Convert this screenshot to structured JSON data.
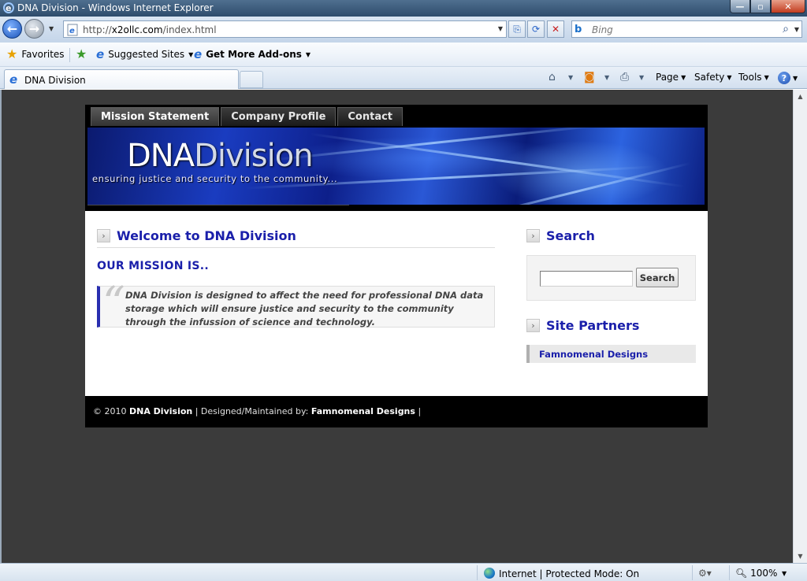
{
  "window": {
    "title": "DNA Division - Windows Internet Explorer",
    "min_label": "—",
    "max_label": "▫",
    "close_label": "✕"
  },
  "nav": {
    "url_prefix": "http://",
    "url_host": "x2ollc.com",
    "url_path": "/index.html",
    "search_placeholder": "Bing"
  },
  "favorites": {
    "favorites_label": "Favorites",
    "suggested_label": "Suggested Sites",
    "addons_label": "Get More Add-ons"
  },
  "tabs": {
    "active_tab": "DNA Division"
  },
  "commandbar": {
    "page_label": "Page",
    "safety_label": "Safety",
    "tools_label": "Tools"
  },
  "site": {
    "nav": [
      "Mission Statement",
      "Company Profile",
      "Contact"
    ],
    "brand_first": "DNA",
    "brand_second": "Division",
    "tagline": "ensuring justice and security to the community...",
    "welcome_title": "Welcome to DNA Division",
    "mission_heading": "OUR MISSION IS..",
    "mission_text": "DNA Division is designed to affect the need for professional DNA data storage which will ensure justice and security to the community through the infussion of science and technology.",
    "search_title": "Search",
    "search_button": "Search",
    "partners_title": "Site Partners",
    "partner_link": "Famnomenal Designs",
    "footer_copy": "© 2010",
    "footer_brand": "DNA Division",
    "footer_mid": "| Designed/Maintained by:",
    "footer_designer": "Famnomenal Designs",
    "footer_end": "|"
  },
  "status": {
    "zone": "Internet | Protected Mode: On",
    "zoom": "100%"
  },
  "colors": {
    "heading_blue": "#1a1faa",
    "page_bg": "#3b3b3b",
    "header_black": "#000000"
  }
}
